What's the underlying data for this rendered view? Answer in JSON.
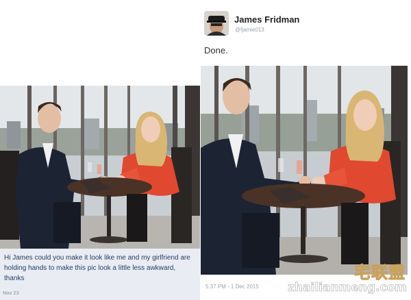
{
  "left_post": {
    "caption": "Hi James could you make it look like me and my girlfriend are holding hands to make this pic look a little less awkward, thanks",
    "date": "Nov 23"
  },
  "right_post": {
    "author_name": "James Fridman",
    "author_handle": "@fjamie013",
    "tweet_text": "Done.",
    "timestamp": "5:37 PM - 1 Dec 2015"
  },
  "watermark": {
    "chinese": "宅联盟",
    "url": "zhailianmeng.com"
  },
  "colors": {
    "caption_bg": "#e9edf3",
    "caption_text": "#1f3a5e",
    "dress_red": "#e0482f",
    "suit_navy": "#1c2333"
  }
}
